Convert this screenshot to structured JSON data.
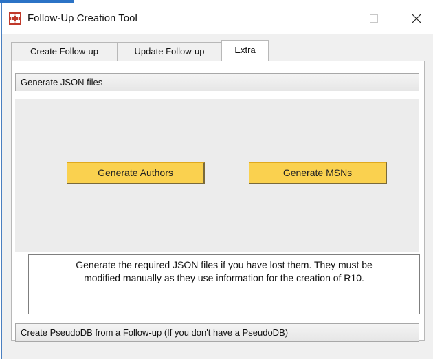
{
  "window": {
    "title": "Follow-Up Creation Tool",
    "icon": "grid-logo-icon",
    "accent_color": "#c0392b"
  },
  "tabs": [
    {
      "label": "Create Follow-up",
      "active": false
    },
    {
      "label": "Update Follow-up",
      "active": false
    },
    {
      "label": "Extra",
      "active": true
    }
  ],
  "extra": {
    "json_section_header": "Generate JSON files",
    "generate_authors_label": "Generate Authors",
    "generate_msns_label": "Generate MSNs",
    "button_color": "#fad14f",
    "info_line1": "Generate the required JSON files if you have lost them. They must be",
    "info_line2": "modified manually as they use information for the creation of R10.",
    "pseudodb_section_header": "Create PseudoDB from a Follow-up (If you don't have a PseudoDB)"
  }
}
